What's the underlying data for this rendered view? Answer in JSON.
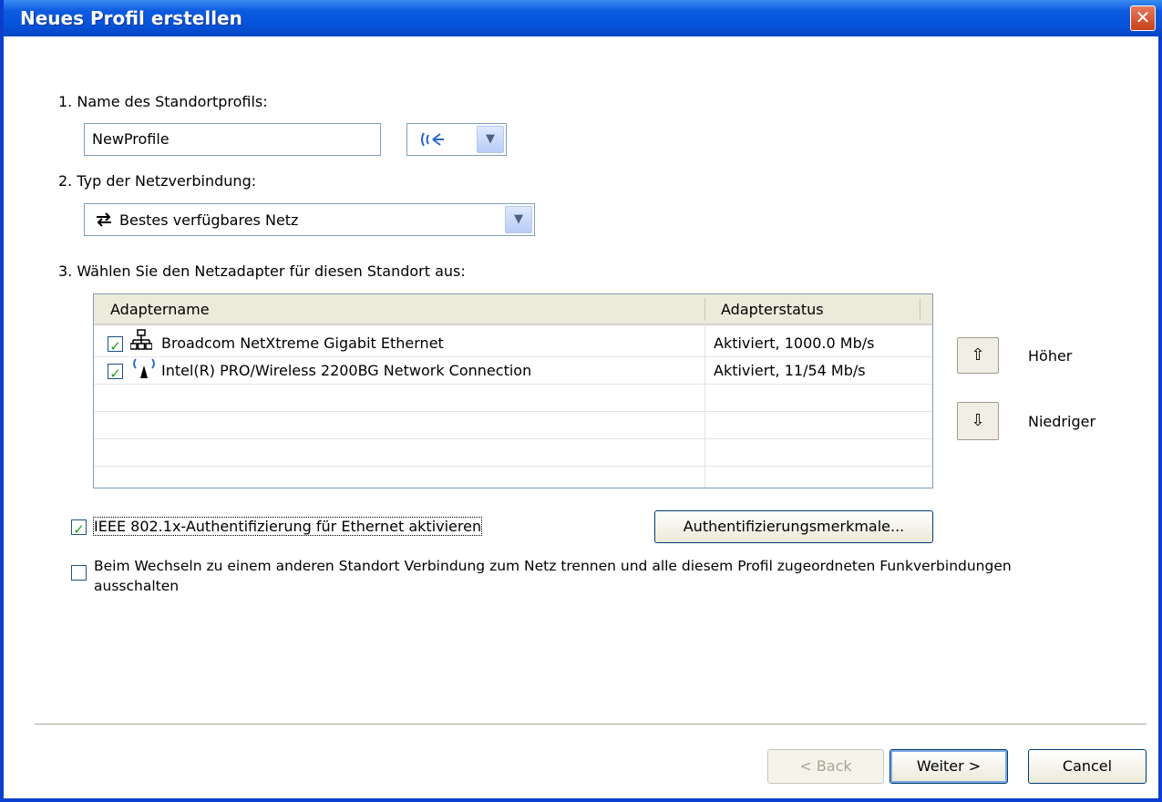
{
  "window": {
    "title": "Neues Profil erstellen",
    "close_glyph": "✕"
  },
  "step1": {
    "label": "1. Name des Standortprofils:",
    "value": "NewProfile",
    "icon": "wireless-broadcast-icon"
  },
  "step2": {
    "label": "2. Typ der Netzverbindung:",
    "selected": "Bestes verfügbares Netz",
    "icon": "network-switch-arrows-icon"
  },
  "step3": {
    "label": "3. Wählen Sie den Netzadapter für diesen Standort aus:",
    "columns": [
      "Adaptername",
      "Adapterstatus"
    ],
    "rows": [
      {
        "checked": true,
        "icon": "wired-network-icon",
        "name": "Broadcom NetXtreme Gigabit Ethernet",
        "status": "Aktiviert, 1000.0 Mb/s"
      },
      {
        "checked": true,
        "icon": "wireless-antenna-icon",
        "name": "Intel(R) PRO/Wireless 2200BG Network Connection",
        "status": "Aktiviert, 11/54 Mb/s"
      }
    ]
  },
  "order": {
    "up_label": "Höher",
    "down_label": "Niedriger"
  },
  "options": {
    "ieee_label": "IEEE 802.1x-Authentifizierung für Ethernet aktivieren",
    "ieee_checked": true,
    "auth_button": "Authentifizierungsmerkmale...",
    "disconnect_label_line1": "Beim Wechseln zu einem anderen Standort Verbindung zum Netz trennen und alle diesem Profil zugeordneten Funkverbindungen",
    "disconnect_label_line2": "ausschalten",
    "disconnect_checked": false
  },
  "footer": {
    "back": "< Back",
    "next": "Weiter >",
    "cancel": "Cancel"
  },
  "colors": {
    "titlebar": "#0553d8",
    "check": "#21a121"
  }
}
